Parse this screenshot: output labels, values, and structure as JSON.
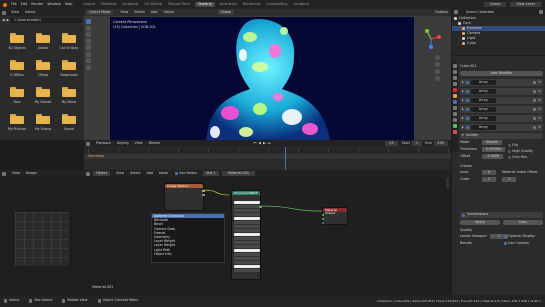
{
  "topbar": {
    "menus": [
      "File",
      "Edit",
      "Render",
      "Window",
      "Help"
    ],
    "workspaces": [
      "Layout",
      "Modeling",
      "Sculpting",
      "UV Editing",
      "Texture Paint",
      "Shading",
      "Animation",
      "Rendering",
      "Compositing",
      "Scripting"
    ],
    "active_workspace": "Shading",
    "scene": "Scene",
    "view_layer": "View Layer"
  },
  "file_browser": {
    "path": "C:\\Users\\mattn\\",
    "menus": [
      "View",
      "Select"
    ],
    "folders": [
      "3D Objects",
      "Adobe",
      "Call of Duty",
      "CCBFiles",
      "CMaps",
      "Downloads",
      "Favs",
      "My Games",
      "My Music",
      "My Pictures",
      "My Videos",
      "Saved"
    ]
  },
  "viewport": {
    "mode": "Object Mode",
    "menus": [
      "View",
      "Select",
      "Add",
      "Object"
    ],
    "transform": "Global",
    "info_line1": "Camera Perspective",
    "info_line2": "(53) Collection | SOB.001",
    "options": "Options"
  },
  "outliner": {
    "title": "Scene Collection",
    "items": [
      "Collection",
      "Cam",
      "Emission",
      "Camera",
      "Light",
      "Cube"
    ]
  },
  "properties": {
    "object_name": "Cube.001",
    "add_modifier": "Add Modifier",
    "modifiers": [
      "Array",
      "Array",
      "Array",
      "Array",
      "Array",
      "Array",
      "Solidify"
    ],
    "labels": [
      "Mode",
      "Simple",
      "Thickness",
      "Offset",
      "Rim",
      "Fill",
      "Only Rim",
      "Normals",
      "Flip",
      "High Quality",
      "Edge Data",
      "Crease",
      "Inner",
      "Outer",
      "Rim",
      "Material Index Offset",
      "Offset",
      "Rim",
      "Shell",
      "Rim",
      "Vertex Groups",
      "Apply",
      "Copy",
      "Subdivisions",
      "Quality",
      "Levels Viewport",
      "Render",
      "Optimal Display",
      "Use Creases"
    ],
    "values": [
      "0.0000m",
      "-1.0000",
      "0",
      "2",
      "1",
      "1"
    ],
    "offset": "Simple"
  },
  "timeline": {
    "menus": [
      "Playback",
      "Keying",
      "View",
      "Marker"
    ],
    "start_label": "Start",
    "start": "1",
    "end_label": "End",
    "end": "250",
    "frame": "53",
    "summary": "Summary"
  },
  "node_editor": {
    "menus": [
      "View",
      "Select",
      "Add",
      "Node"
    ],
    "object": "Object",
    "use_nodes": "Use Nodes",
    "slot": "Slot 1",
    "material": "Material.001",
    "footer_label": "Material.001",
    "add_menu_title": "Ambient Occlusion",
    "add_menu_items": [
      "Ambient Occlusion",
      "Attribute",
      "Bevel",
      "Camera Data",
      "Fresnel",
      "Geometry",
      "Layer Weight",
      "Layer Weight",
      "Light Path",
      "Object Info"
    ],
    "node_bsdf": "Principled BSDF",
    "node_output": "Material Output",
    "node_tex": "Image Texture"
  },
  "image_editor": {
    "menus": [
      "View",
      "Image"
    ]
  },
  "statusbar": {
    "left": "Select",
    "mid": "Box Select",
    "rotate": "Rotate View",
    "context": "Object Context Menu",
    "stats": "Collection | Cube.001 | Verts:125,052 | Faces:110,824 | Tris:221,512 | Objects:1/5 | Mem: 432.1 MiB | v2.90.1"
  },
  "colors": {
    "accent": "#4772b3",
    "bsdf_header": "#2a7a5f",
    "output_header": "#8d2a2f",
    "tex_header": "#a55a3a",
    "folder": "#e7b44d"
  }
}
